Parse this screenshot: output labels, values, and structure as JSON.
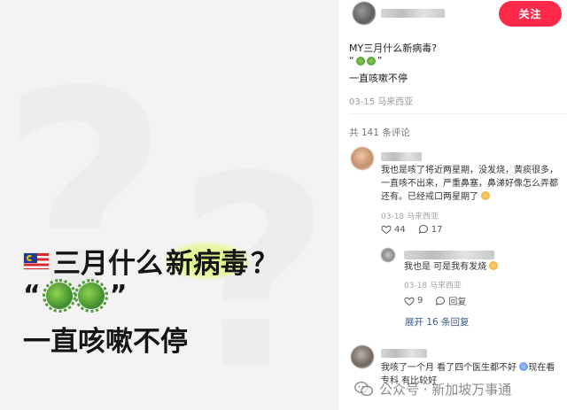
{
  "poster": {
    "title_prefix": "三月什么",
    "title_highlight": "新病毒",
    "title_suffix": "？",
    "quote_open": "“",
    "quote_close": "”",
    "line3": "一直咳嗽不停"
  },
  "header": {
    "follow_label": "关注"
  },
  "post": {
    "title": "MY三月什么新病毒?",
    "emoji_open": "“",
    "emoji_close": "”",
    "line": "一直咳嗽不停",
    "meta": "03-15 马来西亚"
  },
  "comments_header": "共 141 条评论",
  "comments": [
    {
      "text": "我也是咳了将近两星期，没发烧，黄痰很多，一直咳不出来，严重鼻塞，鼻涕好像怎么弄都还有。已经戒口两星期了",
      "meta": "03-18 马来西亚",
      "likes": "44",
      "replies": "17"
    },
    {
      "text": "我也是 可是我有发烧",
      "meta": "03-18 马来西亚",
      "likes": "9",
      "reply_label": "回复"
    },
    {
      "text": "我咳了一个月 看了四个医生都不好",
      "text2": "现在看专科 有比较好"
    }
  ],
  "expand_label": "展开 16 条回复",
  "watermark": "公众号 · 新加坡万事通"
}
